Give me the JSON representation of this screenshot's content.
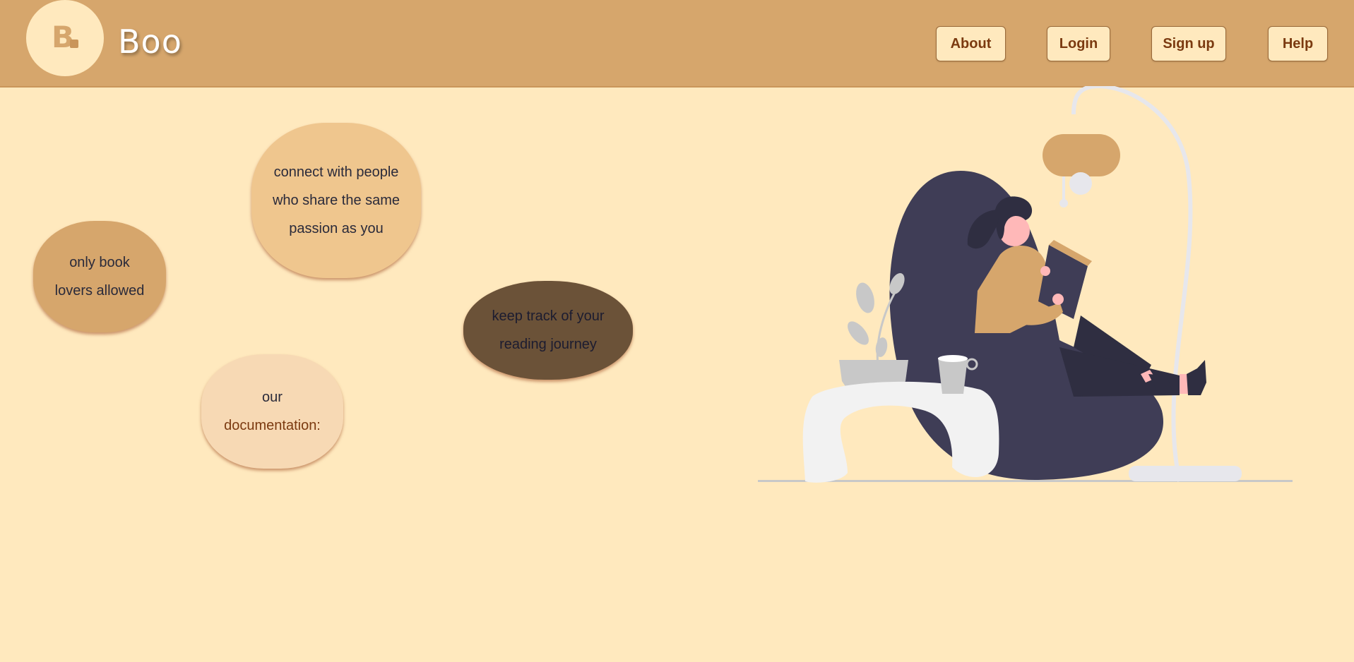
{
  "header": {
    "logo_letter": "B",
    "brand": "Boo",
    "nav": [
      {
        "label": "About"
      },
      {
        "label": "Login"
      },
      {
        "label": "Sign up"
      },
      {
        "label": "Help"
      }
    ]
  },
  "bubbles": {
    "book_lovers": {
      "line1": "only book",
      "line2": "lovers allowed"
    },
    "connect": {
      "line1": "connect with people",
      "line2": "who share the same",
      "line3": "passion as you"
    },
    "track": {
      "line1": "keep track of your",
      "line2": "reading journey"
    },
    "docs": {
      "line1": "our",
      "link": "documentation:"
    }
  },
  "colors": {
    "page_bg": "#ffe9be",
    "header_bg": "#d6a66c",
    "nav_text": "#7b3a10",
    "bubble_tan": "#d6a66c",
    "bubble_light": "#efc68e",
    "bubble_dark": "#6b5238",
    "bubble_pale": "#f7d9b4"
  }
}
